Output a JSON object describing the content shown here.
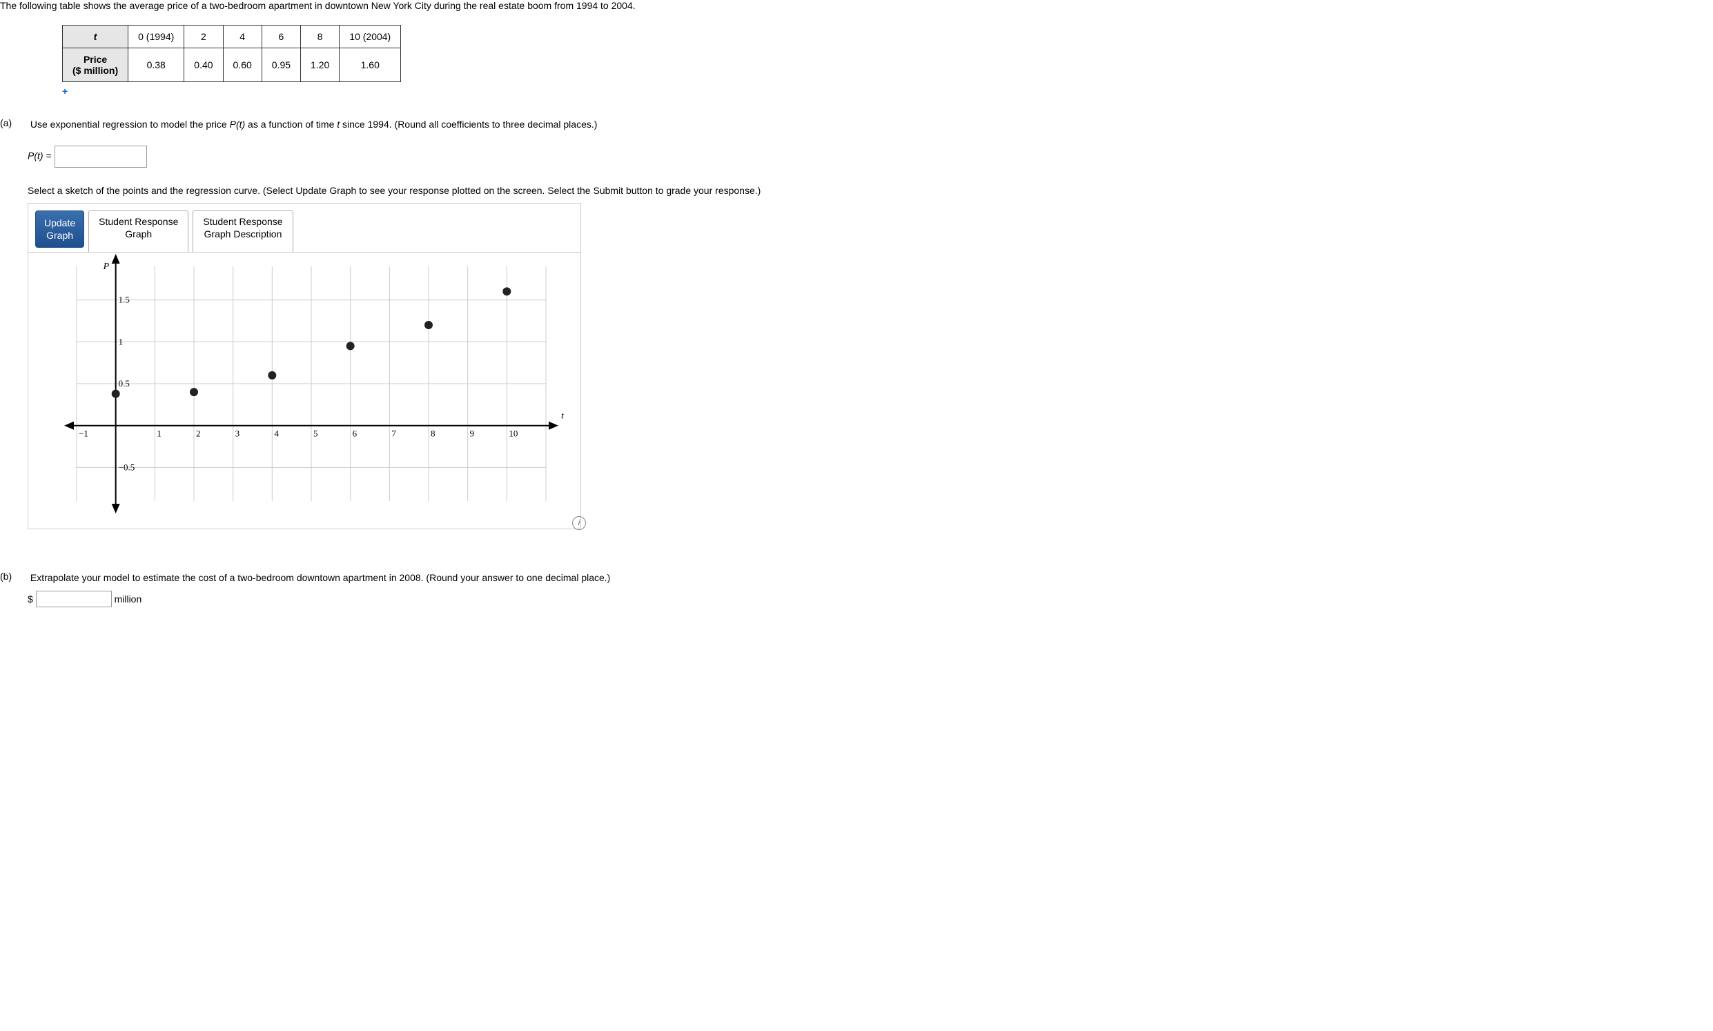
{
  "intro": "The following table shows the average price of a two-bedroom apartment in downtown New York City during the real estate boom from 1994 to 2004.",
  "table": {
    "row1_label_html": "t",
    "row1": [
      "0 (1994)",
      "2",
      "4",
      "6",
      "8",
      "10 (2004)"
    ],
    "row2_label_line1": "Price",
    "row2_label_line2": "($ million)",
    "row2": [
      "0.38",
      "0.40",
      "0.60",
      "0.95",
      "1.20",
      "1.60"
    ]
  },
  "plus": "+",
  "parts": {
    "a_label": "(a)",
    "a_text_prefix": "Use exponential regression to model the price ",
    "a_text_pt": "P(t)",
    "a_text_mid": " as a function of time ",
    "a_text_t": "t",
    "a_text_suffix": " since 1994. (Round all coefficients to three decimal places.)",
    "a_eq_lhs": "P(t) = ",
    "a_select_text": "Select a sketch of the points and the regression curve. (Select Update Graph to see your response plotted on the screen. Select the Submit button to grade your response.)",
    "update_btn_l1": "Update",
    "update_btn_l2": "Graph",
    "tab1_l1": "Student Response",
    "tab1_l2": "Graph",
    "tab2_l1": "Student Response",
    "tab2_l2": "Graph Description",
    "b_label": "(b)",
    "b_text": "Extrapolate your model to estimate the cost of a two-bedroom downtown apartment in 2008. (Round your answer to one decimal place.)",
    "b_dollar": "$",
    "b_unit": "million"
  },
  "chart_data": {
    "type": "scatter",
    "title": "",
    "xlabel": "t",
    "ylabel": "P",
    "xlim": [
      -1,
      11
    ],
    "ylim": [
      -0.9,
      1.9
    ],
    "x_ticks": [
      -1,
      1,
      2,
      3,
      4,
      5,
      6,
      7,
      8,
      9,
      10
    ],
    "y_ticks": [
      -0.5,
      0.5,
      1,
      1.5
    ],
    "series": [
      {
        "name": "points",
        "x": [
          0,
          2,
          4,
          6,
          8,
          10
        ],
        "y": [
          0.38,
          0.4,
          0.6,
          0.95,
          1.2,
          1.6
        ]
      }
    ]
  }
}
